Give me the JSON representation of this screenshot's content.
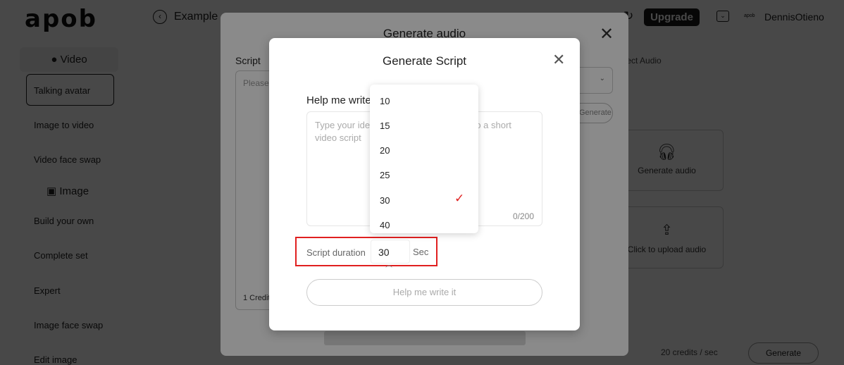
{
  "header": {
    "logo": "apob",
    "back_label": "Example",
    "upgrade": "Upgrade",
    "username": "DennisOtieno",
    "small_logo": "apob"
  },
  "sidebar": {
    "video_header": "Video",
    "image_header": "Image",
    "items": [
      "Talking avatar",
      "Image to video",
      "Video face swap",
      "Build your own",
      "Complete set",
      "Expert",
      "Image face swap",
      "Edit image"
    ]
  },
  "background": {
    "select_audio": "Select Audio",
    "cards": [
      "Generate audio",
      "Click to upload audio"
    ],
    "credits": "20 credits / sec",
    "generate": "Generate"
  },
  "audio_modal": {
    "title": "Generate audio",
    "script_label": "Script",
    "script_placeholder": "Please ... use fo",
    "credit": "1 Credit",
    "side_button": "Generate"
  },
  "script_modal": {
    "title": "Generate Script",
    "help_label": "Help me write",
    "placeholder": "Type your idea and we will transform into a short video script",
    "counter": "0/200",
    "duration_label": "Script duration",
    "duration_value": "30",
    "unit": "Sec",
    "submit": "Help me write it"
  },
  "duration_options": [
    "10",
    "15",
    "20",
    "25",
    "30",
    "40"
  ],
  "selected_option": "30",
  "colors": {
    "accent": "#e02020",
    "highlight_box": "#e02020"
  }
}
